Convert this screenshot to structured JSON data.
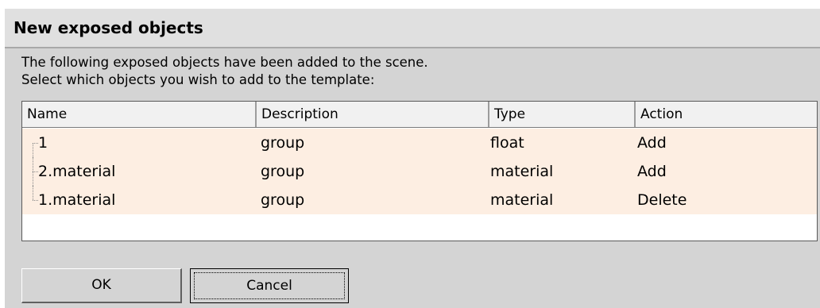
{
  "dialog": {
    "title": "New exposed objects",
    "intro_line1": "The following exposed objects have been added to the scene.",
    "intro_line2": "Select which objects you wish to add to the template:"
  },
  "table": {
    "headers": {
      "name": "Name",
      "description": "Description",
      "type": "Type",
      "action": "Action"
    },
    "rows": [
      {
        "name": "1",
        "description": "group",
        "type": "float",
        "action": "Add"
      },
      {
        "name": "2.material",
        "description": "group",
        "type": "material",
        "action": "Add"
      },
      {
        "name": "1.material",
        "description": "group",
        "type": "material",
        "action": "Delete"
      }
    ]
  },
  "buttons": {
    "ok": "OK",
    "cancel": "Cancel"
  },
  "colors": {
    "row_highlight": "#fdeee2",
    "dialog_bg": "#d4d4d4"
  }
}
